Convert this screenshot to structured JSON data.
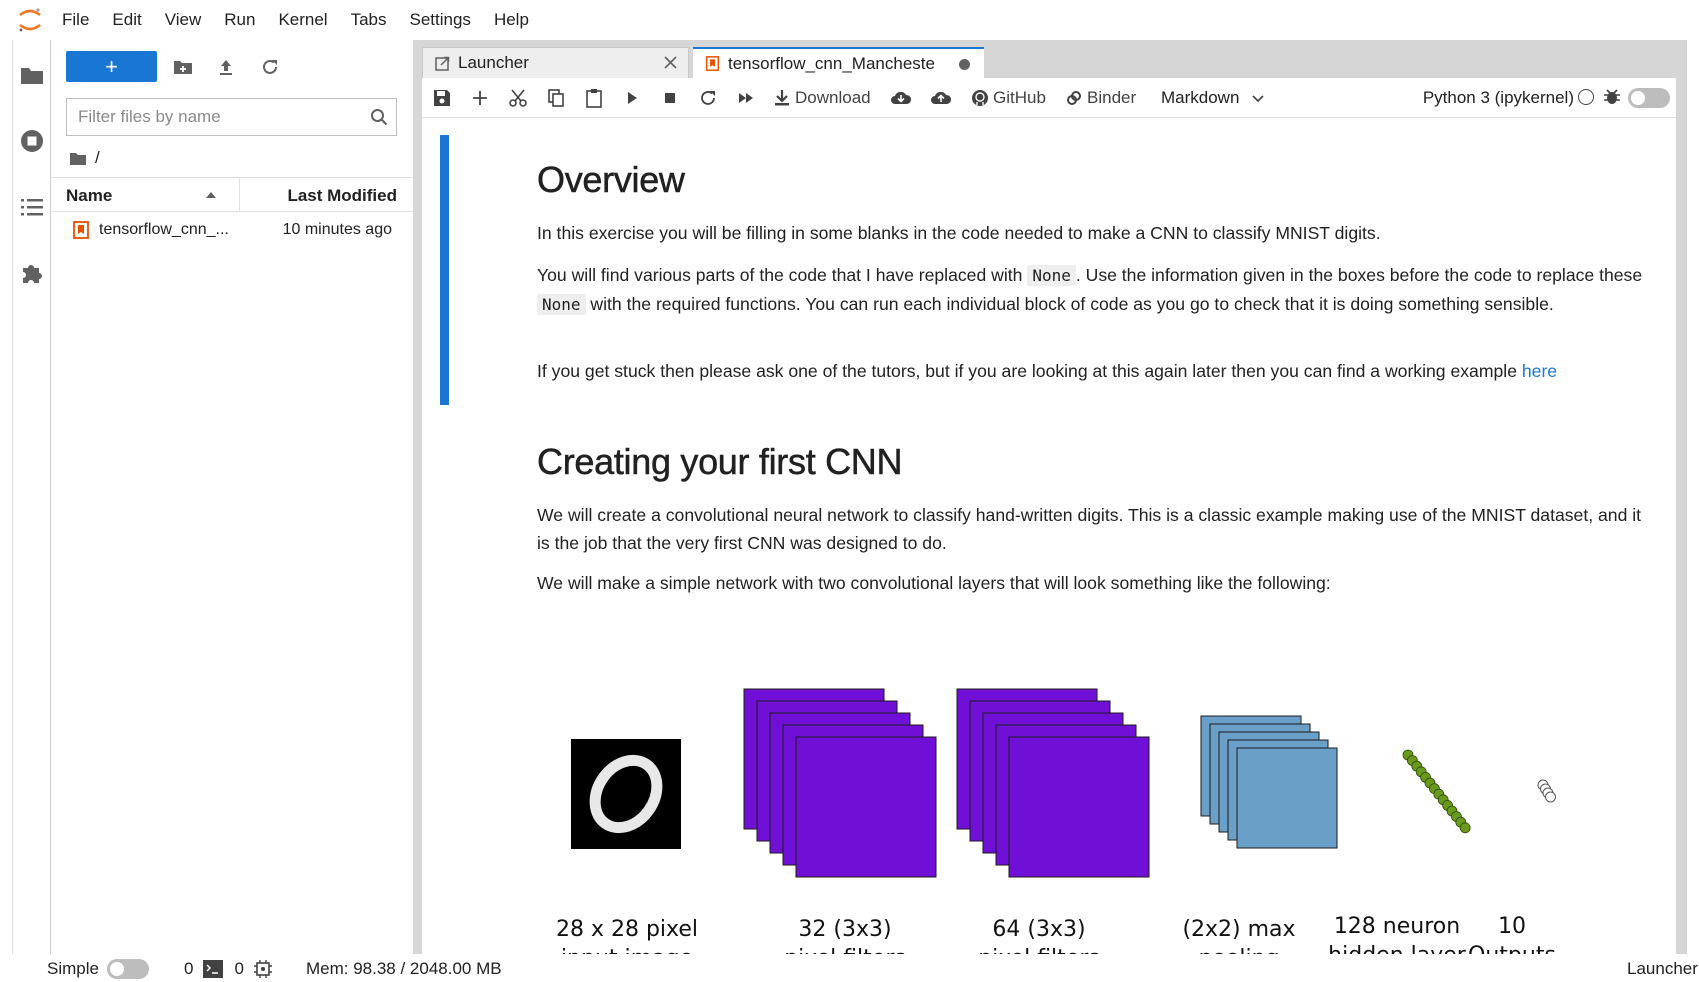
{
  "menubar": {
    "items": [
      "File",
      "Edit",
      "View",
      "Run",
      "Kernel",
      "Tabs",
      "Settings",
      "Help"
    ]
  },
  "filebrowser": {
    "new_label": "+",
    "filter_placeholder": "Filter files by name",
    "breadcrumb": "/",
    "columns": {
      "name": "Name",
      "modified": "Last Modified"
    },
    "files": [
      {
        "name": "tensorflow_cnn_...",
        "modified": "10 minutes ago",
        "icon": "notebook-icon"
      }
    ]
  },
  "tabs": [
    {
      "label": "Launcher",
      "icon": "launcher-icon"
    },
    {
      "label": "tensorflow_cnn_Mancheste",
      "icon": "notebook-icon"
    }
  ],
  "toolbar": {
    "download": "Download",
    "github": "GitHub",
    "binder": "Binder",
    "cell_type": "Markdown",
    "kernel": "Python 3 (ipykernel)"
  },
  "notebook": {
    "h1_overview": "Overview",
    "p1": "In this exercise you will be filling in some blanks in the code needed to make a CNN to classify MNIST digits.",
    "p2_a": "You will find various parts of the code that I have replaced with ",
    "p2_code1": "None",
    "p2_b": ". Use the information given in the boxes before the code to replace these ",
    "p2_code2": "None",
    "p2_c": " with the required functions. You can run each individual block of code as you go to check that it is doing something sensible.",
    "p3_a": "If you get stuck then please ask one of the tutors, but if you are looking at this again later then you can find a working example ",
    "p3_link": "here",
    "h1_cnn": "Creating your first CNN",
    "p4": "We will create a convolutional neural network to classify hand-written digits. This is a classic example making use of the MNIST dataset, and it is the job that the very first CNN was designed to do.",
    "p5": "We will make a simple network with two convolutional layers that will look something like the following:"
  },
  "diagram": {
    "captions": [
      {
        "line1": "28 x 28 pixel",
        "line2": "input image"
      },
      {
        "line1": "32 (3x3)",
        "line2": "pixel filters"
      },
      {
        "line1": "64 (3x3)",
        "line2": "pixel filters"
      },
      {
        "line1": "(2x2) max",
        "line2": "pooling"
      },
      {
        "line1": "128 neuron",
        "line2": "hidden layer"
      },
      {
        "line1": "10",
        "line2": "Outputs"
      }
    ],
    "colors": {
      "filters": "#7010d6",
      "pooling": "#6aa0c8",
      "neurons": "#6a9a1c"
    }
  },
  "statusbar": {
    "mode": "Simple",
    "terminals": "0",
    "kernels": "0",
    "memory": "Mem: 98.38 / 2048.00 MB",
    "right": "Launcher"
  },
  "colors": {
    "accent": "#1976d2",
    "notebook_icon": "#e65100"
  }
}
